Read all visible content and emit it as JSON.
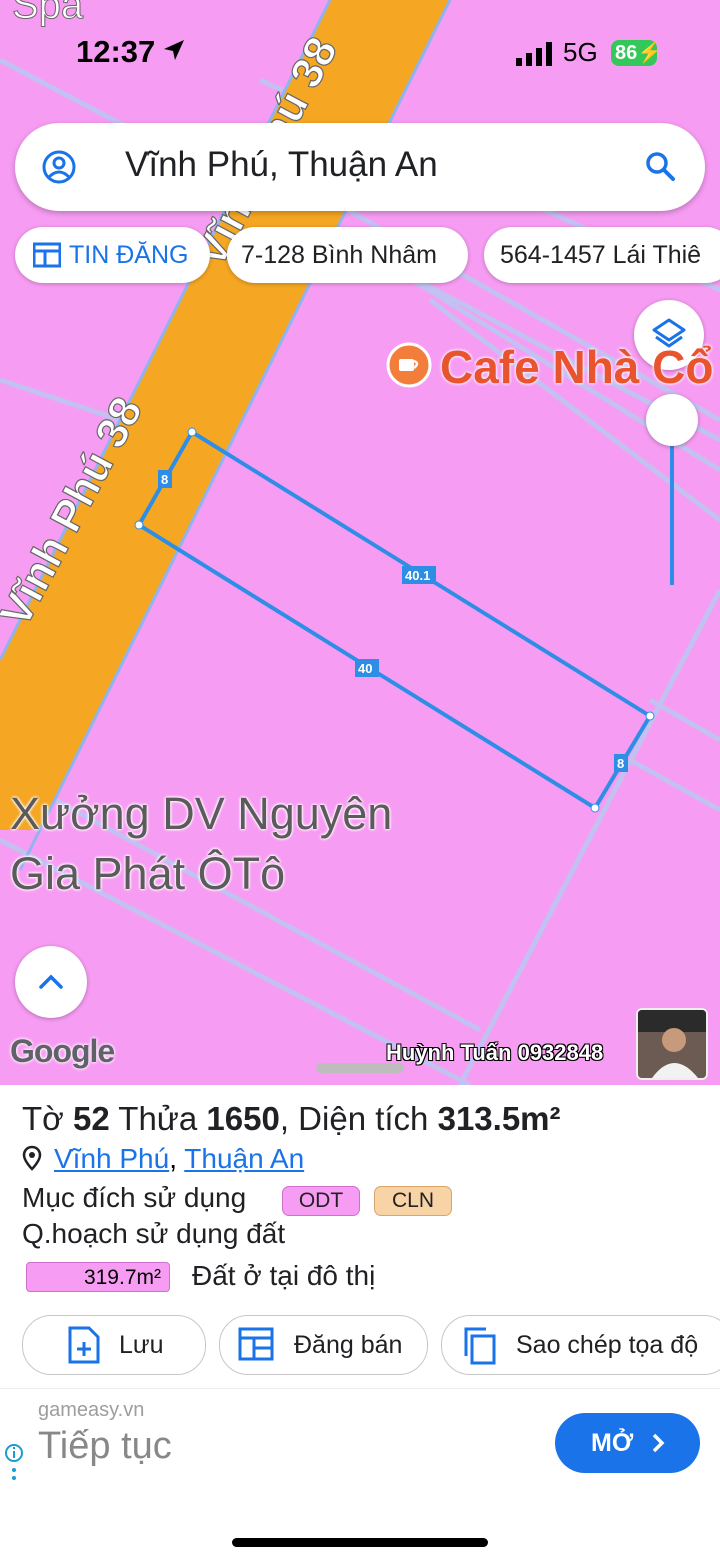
{
  "status_bar": {
    "time": "12:37",
    "network": "5G",
    "battery": "86"
  },
  "search": {
    "query": "Vĩnh Phú, Thuận An"
  },
  "chips": [
    {
      "label": "TIN ĐĂNG"
    },
    {
      "label": "7-128 Bình Nhâm"
    },
    {
      "label": "564-1457 Lái Thiê"
    }
  ],
  "map": {
    "top_label": "Spa",
    "road_label_1": "Vĩnh Phú 38",
    "road_label_2": "Vĩnh Phú 38",
    "poi_label": "Cafe Nhà Cổ",
    "place_label_line1": "Xưởng DV Nguyên",
    "place_label_line2": "Gia Phát ÔTô",
    "edge_lengths": {
      "left": "8",
      "top": "40.1",
      "bottom": "40",
      "right": "8"
    },
    "google_logo": "Google",
    "watermark": "Huỳnh Tuấn 0932848",
    "colors": {
      "land": "#f79cf3",
      "road": "#f5a623",
      "plot": "#2e8ee6"
    }
  },
  "parcel": {
    "title_prefix": "Tờ",
    "sheet_no": "52",
    "lot_prefix": "Thửa",
    "lot_no": "1650",
    "area_prefix": ", Diện tích",
    "area": "313.5m²",
    "ward": "Vĩnh Phú",
    "district": "Thuận An",
    "purpose_label": "Mục đích sử dụng",
    "purpose_tags": [
      "ODT",
      "CLN"
    ],
    "planning_label": "Q.hoạch sử dụng đất",
    "planning_area": "319.7m²",
    "planning_desc": "Đất ở tại đô thị"
  },
  "actions": {
    "save": "Lưu",
    "post": "Đăng bán",
    "copy": "Sao chép tọa độ"
  },
  "ad": {
    "source": "gameasy.vn",
    "cta": "Tiếp tục",
    "open": "MỞ"
  }
}
